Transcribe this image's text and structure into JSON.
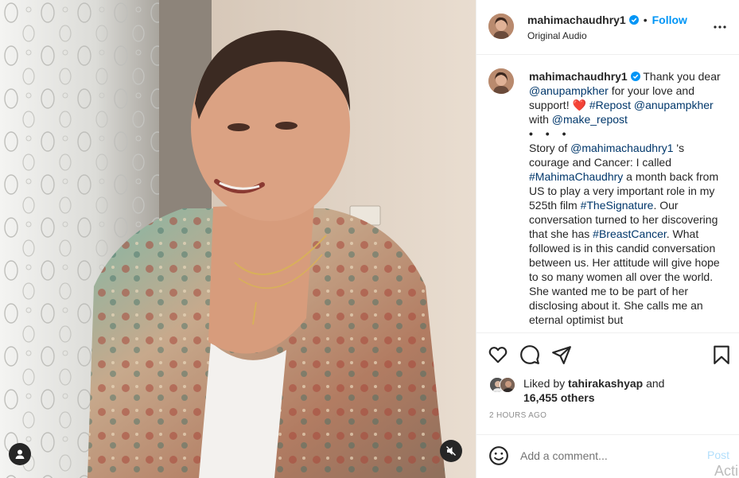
{
  "header": {
    "username": "mahimachaudhry1",
    "follow_label": "Follow",
    "separator": "•",
    "audio": "Original Audio"
  },
  "caption": {
    "username": "mahimachaudhry1",
    "t1": " Thank you dear ",
    "m1": "@anupampkher",
    "t2": " for your love and support! ",
    "heart": "❤️",
    "t3": " ",
    "h1": "#Repost",
    "t4": " ",
    "m2": "@anupampkher",
    "t5": " with ",
    "m3": "@make_repost",
    "dots": "• • •",
    "t6": "Story of ",
    "m4": "@mahimachaudhry1",
    "t7": " 's courage and Cancer: I called ",
    "h2": "#MahimaChaudhry",
    "t8": " a month back from US to play a very important role in my 525th film ",
    "h3": "#TheSignature",
    "t9": ". Our conversation turned to her discovering that she has ",
    "h4": "#BreastCancer",
    "t10": ". What followed is in this candid conversation between us. Her attitude will give hope to so many women all over the world. She wanted me to be part of her disclosing about it. She calls me an eternal optimist but"
  },
  "likes": {
    "prefix": "Liked by ",
    "user": "tahirakashyap",
    "and": " and",
    "count": "16,455 others"
  },
  "timestamp": "2 HOURS AGO",
  "comment": {
    "placeholder": "Add a comment...",
    "post_label": "Post"
  },
  "watermark": "Acti",
  "icons": {
    "verified": "verified-badge-icon",
    "more": "more-options-icon",
    "like": "heart-icon",
    "comment": "comment-icon",
    "share": "share-icon",
    "save": "bookmark-icon",
    "emoji": "emoji-icon",
    "tags": "user-tag-icon",
    "mute": "mute-icon"
  },
  "colors": {
    "accent": "#0095f6",
    "link": "#00376b",
    "post_disabled": "#b2dffc",
    "muted_text": "#8e8e8e"
  }
}
